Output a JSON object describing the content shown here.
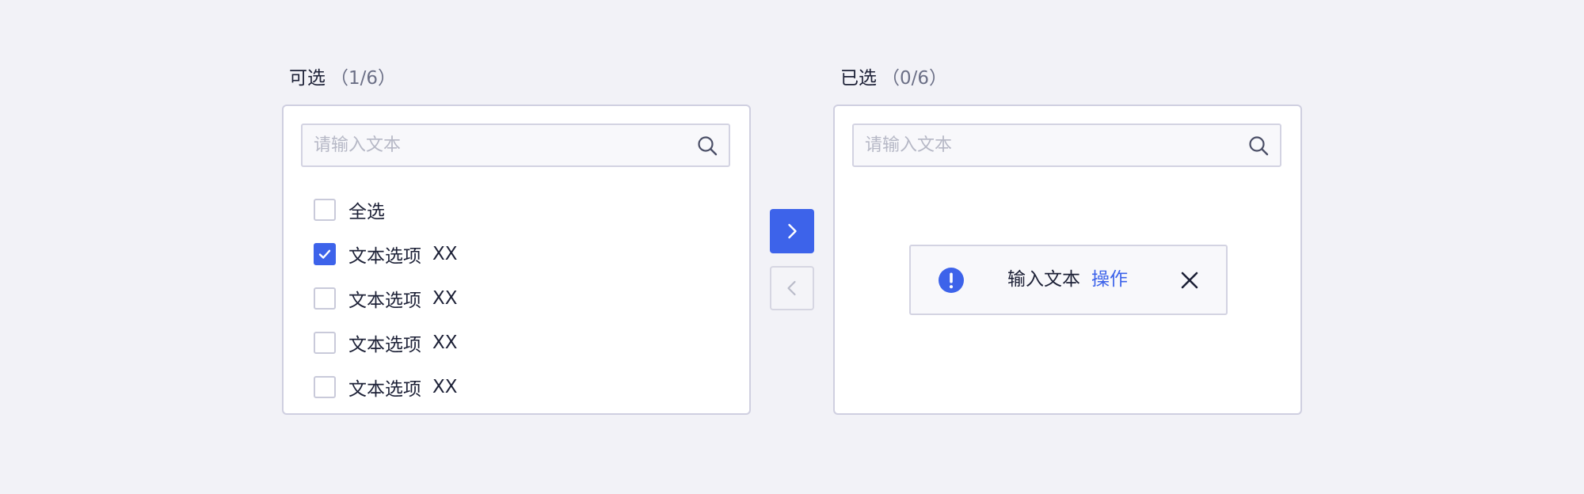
{
  "colors": {
    "background": "#f2f2f7",
    "accent": "#3d63ea",
    "text": "#1c2036",
    "muted": "#6b6f86",
    "border": "#cfcfe0",
    "placeholder": "#b6b8c6"
  },
  "source": {
    "title": "可选",
    "count": "（1/6）",
    "search_placeholder": "请输入文本",
    "search_icon": "search-icon",
    "select_all_label": "全选",
    "select_all_checked": false,
    "options": [
      {
        "label": "文本选项",
        "tag": "XX",
        "checked": true
      },
      {
        "label": "文本选项",
        "tag": "XX",
        "checked": false
      },
      {
        "label": "文本选项",
        "tag": "XX",
        "checked": false
      },
      {
        "label": "文本选项",
        "tag": "XX",
        "checked": false
      }
    ]
  },
  "target": {
    "title": "已选",
    "count": "（0/6）",
    "search_placeholder": "请输入文本",
    "search_icon": "search-icon"
  },
  "transfer": {
    "to_right_icon": "chevron-right-icon",
    "to_left_icon": "chevron-left-icon"
  },
  "notice": {
    "icon": "exclamation-circle-icon",
    "text": "输入文本",
    "action": "操作",
    "close_icon": "close-icon"
  }
}
